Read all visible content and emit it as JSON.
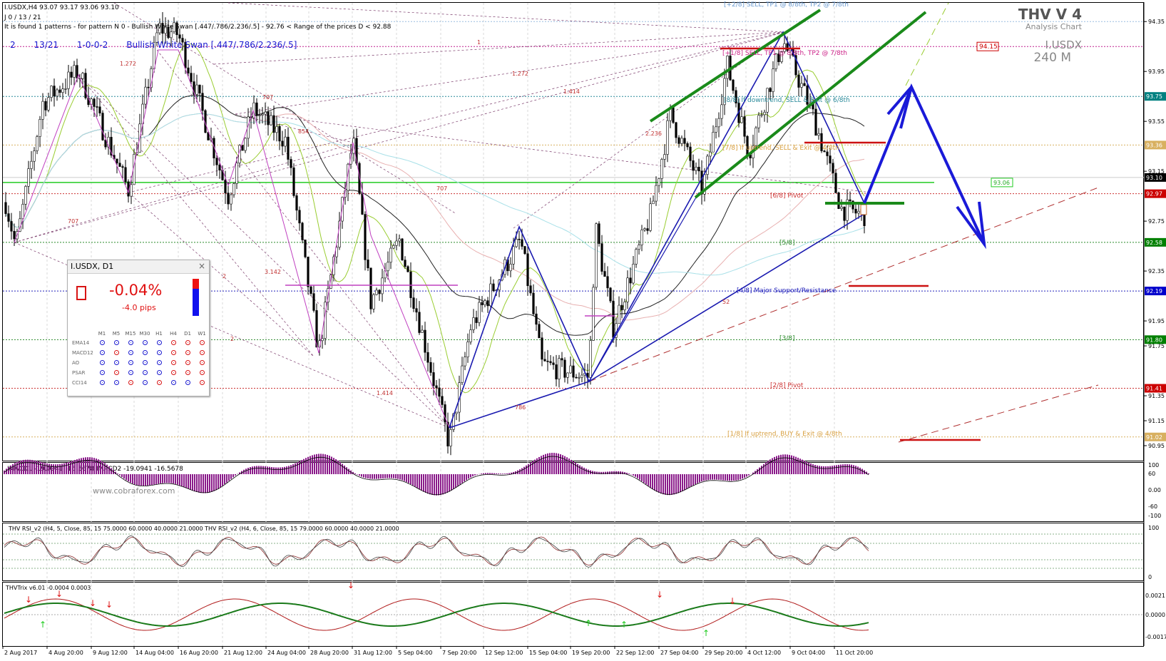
{
  "header": {
    "symbol_line": "I.USDX,H4  93.07 93.17 93.06 93.10",
    "line2": "J 0 / 13 / 21",
    "line3": "It is found 1 patterns  -  for pattern N 0 - Bullish White Swan [.447/.786/2.236/.5] - 92.76 < Range of the prices D < 92.88",
    "pattern_row": [
      "2",
      "13/21",
      "1-0-0-2",
      "Bullish White Swan [.447/.786/2.236/.5]"
    ]
  },
  "logo": {
    "title": "THV V 4",
    "subtitle": "Analysis Chart",
    "symbol": "I.USDX",
    "timeframe": "240 M"
  },
  "price_axis": {
    "ticks": [
      "94.35",
      "93.95",
      "93.55",
      "93.15",
      "92.75",
      "92.35",
      "91.95",
      "91.75",
      "91.35",
      "91.15",
      "90.95"
    ],
    "tags": [
      {
        "text": "94.15",
        "color": "#ffffff",
        "border": "#cc0000",
        "text_color": "#cc0000"
      },
      {
        "text": "93.75",
        "color": "#008080"
      },
      {
        "text": "93.36",
        "color": "#d8b060"
      },
      {
        "text": "93.10",
        "color": "#000000"
      },
      {
        "text": "92.97",
        "color": "#cc0000"
      },
      {
        "text": "92.58",
        "color": "#008000"
      },
      {
        "text": "92.19",
        "color": "#0000cc"
      },
      {
        "text": "91.80",
        "color": "#008000"
      },
      {
        "text": "91.41",
        "color": "#cc0000"
      },
      {
        "text": "91.02",
        "color": "#d8b060"
      }
    ],
    "inline_tag": "93.06"
  },
  "murrey": [
    {
      "text": "[+2/8] SELL, TP1 @ 8/8th, TP2 @ 7/8th",
      "color": "#6a9ad0"
    },
    {
      "text": "[+1/8] SELL, TP1 @ 8/8th, TP2 @ 7/8th",
      "color": "#cc2288"
    },
    {
      "text": "[8/8] If downtrend, SELL & Exit @ 6/8th",
      "color": "#2a8a9a"
    },
    {
      "text": "[7/8] If uptrend, SELL & Exit @ 4/8th",
      "color": "#d8a040"
    },
    {
      "text": "[6/8] Pivot",
      "color": "#cc3333"
    },
    {
      "text": "[5/8]",
      "color": "#2a8a2a"
    },
    {
      "text": "[4/8] Major Support/Resistance",
      "color": "#2222bb"
    },
    {
      "text": "[3/8]",
      "color": "#2a8a2a"
    },
    {
      "text": "[2/8] Pivot",
      "color": "#cc3333"
    },
    {
      "text": "[1/8] If uptrend, BUY & Exit @ 4/8th",
      "color": "#d8a040"
    }
  ],
  "fib_labels": [
    "1.272",
    "707",
    "854",
    "1.414",
    "1.272",
    "1",
    "2.236",
    "707",
    "707",
    "3.142",
    "2",
    "2",
    "1.414",
    "786",
    "52"
  ],
  "widget": {
    "title": "I.USDX, D1",
    "close": "×",
    "change_pct": "-0.04%",
    "change_pips": "-4.0 pips",
    "columns": [
      "M1",
      "M5",
      "M15",
      "M30",
      "H1",
      "H4",
      "D1",
      "W1"
    ],
    "rows": [
      {
        "name": "EMA14",
        "dots": [
          "blue",
          "blue",
          "blue",
          "blue",
          "blue",
          "red",
          "red",
          "red"
        ]
      },
      {
        "name": "MACD12",
        "dots": [
          "blue",
          "red",
          "blue",
          "blue",
          "blue",
          "red",
          "red",
          "red"
        ]
      },
      {
        "name": "AO",
        "dots": [
          "blue",
          "blue",
          "blue",
          "blue",
          "blue",
          "red",
          "red",
          "red"
        ]
      },
      {
        "name": "PSAR",
        "dots": [
          "blue",
          "red",
          "blue",
          "blue",
          "blue",
          "red",
          "red",
          "red"
        ]
      },
      {
        "name": "CCI14",
        "dots": [
          "blue",
          "blue",
          "red",
          "blue",
          "red",
          "blue",
          "blue",
          "red"
        ]
      }
    ]
  },
  "macd": {
    "label": "IMACD1 -19.0941 -16.5678  IMACD2 -19.0941 -16.5678",
    "ticks": [
      "100",
      "60",
      "0.00",
      "-60",
      "-100"
    ],
    "watermark": "www.cobraforex.com"
  },
  "rsi": {
    "label": "THV RSI_v2  (H4, 5, Close, 85, 15 75.0000 60.0000 40.0000 21.0000   THV RSI_v2  (H4, 6, Close, 85, 15 79.0000 60.0000 40.0000 21.0000",
    "ticks": [
      "100",
      "0"
    ]
  },
  "trix": {
    "label": "THVTrix v6.01 -0.0004 0.0003",
    "ticks": [
      "0.0021",
      "0.0000",
      "-0.0017"
    ]
  },
  "time_axis": [
    "2 Aug 2017",
    "4 Aug 20:00",
    "9 Aug 12:00",
    "14 Aug 04:00",
    "16 Aug 20:00",
    "21 Aug 12:00",
    "24 Aug 04:00",
    "28 Aug 20:00",
    "31 Aug 12:00",
    "5 Sep 04:00",
    "7 Sep 20:00",
    "12 Sep 12:00",
    "15 Sep 04:00",
    "19 Sep 20:00",
    "22 Sep 12:00",
    "27 Sep 04:00",
    "29 Sep 20:00",
    "4 Oct 12:00",
    "9 Oct 04:00",
    "11 Oct 20:00"
  ],
  "colors": {
    "candle": "#000000",
    "ma_dark": "#222222",
    "ma_green": "#9acd32",
    "ma_pink": "#e8b0b0",
    "ma_cyan": "#a8e0e8",
    "blue_pattern": "#1a1ab0",
    "magenta_pattern": "#c040c0",
    "green_channel": "#1a8a1a",
    "forecast": "#1a1ad8",
    "macd_hist": "#8a1a8a",
    "trix_green": "#1a7a1a",
    "trix_red": "#b01a1a"
  }
}
